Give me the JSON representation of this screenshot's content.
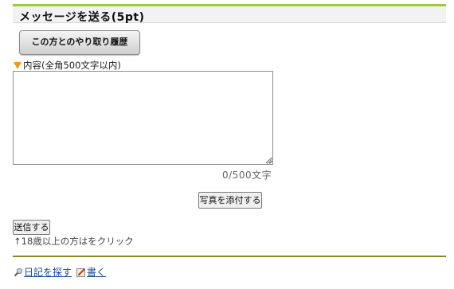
{
  "header": {
    "title": "メッセージを送る(5pt)"
  },
  "history_button": {
    "label": "この方とのやり取り履歴"
  },
  "content": {
    "label": "内容(全角500文字以内)",
    "value": "",
    "counter": "0/500文字"
  },
  "photo_button": {
    "label": "写真を添付する"
  },
  "send_button": {
    "label": "送信する"
  },
  "age_note": "↑18歳以上の方はをクリック",
  "footer": {
    "search_diary": "日記を探す",
    "write": "書く",
    "search_icon": "magnifier-icon",
    "write_icon": "pencil-note-icon"
  },
  "colors": {
    "accent_green": "#9acd32",
    "arrow_orange": "#f29a1a",
    "link_blue": "#1a4fa0"
  }
}
